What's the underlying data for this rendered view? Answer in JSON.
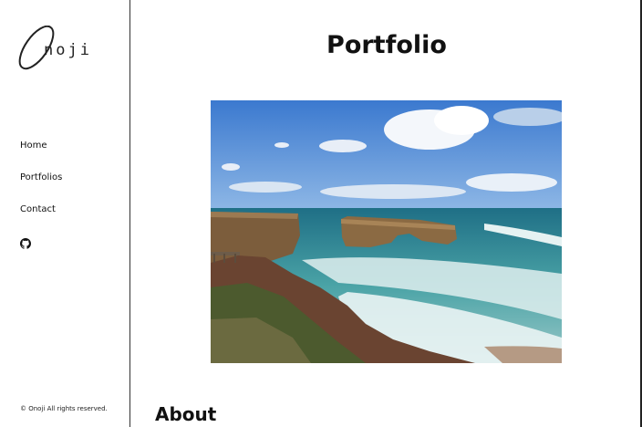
{
  "brand": {
    "logo_text": "noji"
  },
  "nav": {
    "items": [
      {
        "label": "Home"
      },
      {
        "label": "Portfolios"
      },
      {
        "label": "Contact"
      }
    ],
    "github_icon": "github-icon"
  },
  "footer": {
    "text": "© Onoji All rights reserved."
  },
  "main": {
    "title": "Portfolio",
    "image": {
      "subject": "coastal-arch-photo"
    },
    "section_title": "About"
  },
  "colors": {
    "sky": "#4a86d0",
    "ocean": "#2f8b9e",
    "cliff": "#8a6a45",
    "ground": "#5a3a2a",
    "border": "#333333"
  }
}
